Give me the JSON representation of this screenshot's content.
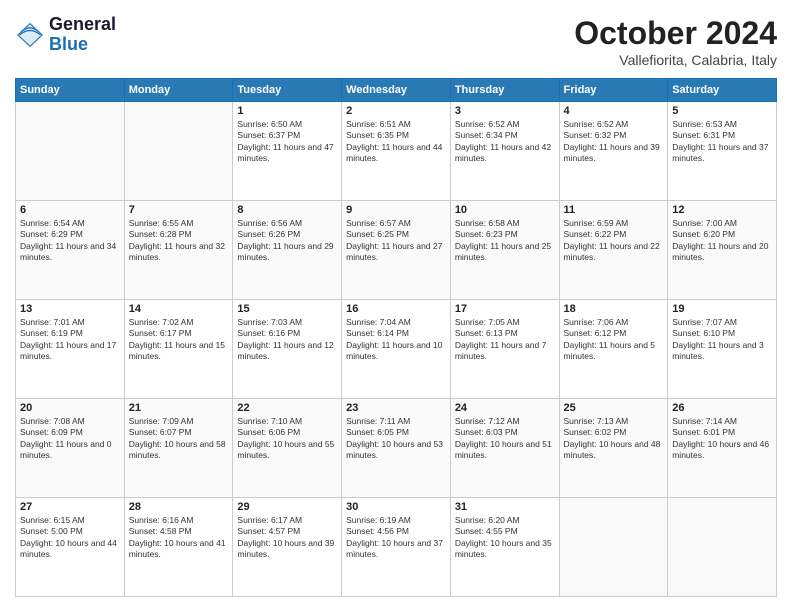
{
  "header": {
    "logo_line1": "General",
    "logo_line2": "Blue",
    "month_title": "October 2024",
    "subtitle": "Vallefiorita, Calabria, Italy"
  },
  "weekdays": [
    "Sunday",
    "Monday",
    "Tuesday",
    "Wednesday",
    "Thursday",
    "Friday",
    "Saturday"
  ],
  "weeks": [
    [
      {
        "day": "",
        "sunrise": "",
        "sunset": "",
        "daylight": ""
      },
      {
        "day": "",
        "sunrise": "",
        "sunset": "",
        "daylight": ""
      },
      {
        "day": "1",
        "sunrise": "Sunrise: 6:50 AM",
        "sunset": "Sunset: 6:37 PM",
        "daylight": "Daylight: 11 hours and 47 minutes."
      },
      {
        "day": "2",
        "sunrise": "Sunrise: 6:51 AM",
        "sunset": "Sunset: 6:35 PM",
        "daylight": "Daylight: 11 hours and 44 minutes."
      },
      {
        "day": "3",
        "sunrise": "Sunrise: 6:52 AM",
        "sunset": "Sunset: 6:34 PM",
        "daylight": "Daylight: 11 hours and 42 minutes."
      },
      {
        "day": "4",
        "sunrise": "Sunrise: 6:52 AM",
        "sunset": "Sunset: 6:32 PM",
        "daylight": "Daylight: 11 hours and 39 minutes."
      },
      {
        "day": "5",
        "sunrise": "Sunrise: 6:53 AM",
        "sunset": "Sunset: 6:31 PM",
        "daylight": "Daylight: 11 hours and 37 minutes."
      }
    ],
    [
      {
        "day": "6",
        "sunrise": "Sunrise: 6:54 AM",
        "sunset": "Sunset: 6:29 PM",
        "daylight": "Daylight: 11 hours and 34 minutes."
      },
      {
        "day": "7",
        "sunrise": "Sunrise: 6:55 AM",
        "sunset": "Sunset: 6:28 PM",
        "daylight": "Daylight: 11 hours and 32 minutes."
      },
      {
        "day": "8",
        "sunrise": "Sunrise: 6:56 AM",
        "sunset": "Sunset: 6:26 PM",
        "daylight": "Daylight: 11 hours and 29 minutes."
      },
      {
        "day": "9",
        "sunrise": "Sunrise: 6:57 AM",
        "sunset": "Sunset: 6:25 PM",
        "daylight": "Daylight: 11 hours and 27 minutes."
      },
      {
        "day": "10",
        "sunrise": "Sunrise: 6:58 AM",
        "sunset": "Sunset: 6:23 PM",
        "daylight": "Daylight: 11 hours and 25 minutes."
      },
      {
        "day": "11",
        "sunrise": "Sunrise: 6:59 AM",
        "sunset": "Sunset: 6:22 PM",
        "daylight": "Daylight: 11 hours and 22 minutes."
      },
      {
        "day": "12",
        "sunrise": "Sunrise: 7:00 AM",
        "sunset": "Sunset: 6:20 PM",
        "daylight": "Daylight: 11 hours and 20 minutes."
      }
    ],
    [
      {
        "day": "13",
        "sunrise": "Sunrise: 7:01 AM",
        "sunset": "Sunset: 6:19 PM",
        "daylight": "Daylight: 11 hours and 17 minutes."
      },
      {
        "day": "14",
        "sunrise": "Sunrise: 7:02 AM",
        "sunset": "Sunset: 6:17 PM",
        "daylight": "Daylight: 11 hours and 15 minutes."
      },
      {
        "day": "15",
        "sunrise": "Sunrise: 7:03 AM",
        "sunset": "Sunset: 6:16 PM",
        "daylight": "Daylight: 11 hours and 12 minutes."
      },
      {
        "day": "16",
        "sunrise": "Sunrise: 7:04 AM",
        "sunset": "Sunset: 6:14 PM",
        "daylight": "Daylight: 11 hours and 10 minutes."
      },
      {
        "day": "17",
        "sunrise": "Sunrise: 7:05 AM",
        "sunset": "Sunset: 6:13 PM",
        "daylight": "Daylight: 11 hours and 7 minutes."
      },
      {
        "day": "18",
        "sunrise": "Sunrise: 7:06 AM",
        "sunset": "Sunset: 6:12 PM",
        "daylight": "Daylight: 11 hours and 5 minutes."
      },
      {
        "day": "19",
        "sunrise": "Sunrise: 7:07 AM",
        "sunset": "Sunset: 6:10 PM",
        "daylight": "Daylight: 11 hours and 3 minutes."
      }
    ],
    [
      {
        "day": "20",
        "sunrise": "Sunrise: 7:08 AM",
        "sunset": "Sunset: 6:09 PM",
        "daylight": "Daylight: 11 hours and 0 minutes."
      },
      {
        "day": "21",
        "sunrise": "Sunrise: 7:09 AM",
        "sunset": "Sunset: 6:07 PM",
        "daylight": "Daylight: 10 hours and 58 minutes."
      },
      {
        "day": "22",
        "sunrise": "Sunrise: 7:10 AM",
        "sunset": "Sunset: 6:06 PM",
        "daylight": "Daylight: 10 hours and 55 minutes."
      },
      {
        "day": "23",
        "sunrise": "Sunrise: 7:11 AM",
        "sunset": "Sunset: 6:05 PM",
        "daylight": "Daylight: 10 hours and 53 minutes."
      },
      {
        "day": "24",
        "sunrise": "Sunrise: 7:12 AM",
        "sunset": "Sunset: 6:03 PM",
        "daylight": "Daylight: 10 hours and 51 minutes."
      },
      {
        "day": "25",
        "sunrise": "Sunrise: 7:13 AM",
        "sunset": "Sunset: 6:02 PM",
        "daylight": "Daylight: 10 hours and 48 minutes."
      },
      {
        "day": "26",
        "sunrise": "Sunrise: 7:14 AM",
        "sunset": "Sunset: 6:01 PM",
        "daylight": "Daylight: 10 hours and 46 minutes."
      }
    ],
    [
      {
        "day": "27",
        "sunrise": "Sunrise: 6:15 AM",
        "sunset": "Sunset: 5:00 PM",
        "daylight": "Daylight: 10 hours and 44 minutes."
      },
      {
        "day": "28",
        "sunrise": "Sunrise: 6:16 AM",
        "sunset": "Sunset: 4:58 PM",
        "daylight": "Daylight: 10 hours and 41 minutes."
      },
      {
        "day": "29",
        "sunrise": "Sunrise: 6:17 AM",
        "sunset": "Sunset: 4:57 PM",
        "daylight": "Daylight: 10 hours and 39 minutes."
      },
      {
        "day": "30",
        "sunrise": "Sunrise: 6:19 AM",
        "sunset": "Sunset: 4:56 PM",
        "daylight": "Daylight: 10 hours and 37 minutes."
      },
      {
        "day": "31",
        "sunrise": "Sunrise: 6:20 AM",
        "sunset": "Sunset: 4:55 PM",
        "daylight": "Daylight: 10 hours and 35 minutes."
      },
      {
        "day": "",
        "sunrise": "",
        "sunset": "",
        "daylight": ""
      },
      {
        "day": "",
        "sunrise": "",
        "sunset": "",
        "daylight": ""
      }
    ]
  ]
}
